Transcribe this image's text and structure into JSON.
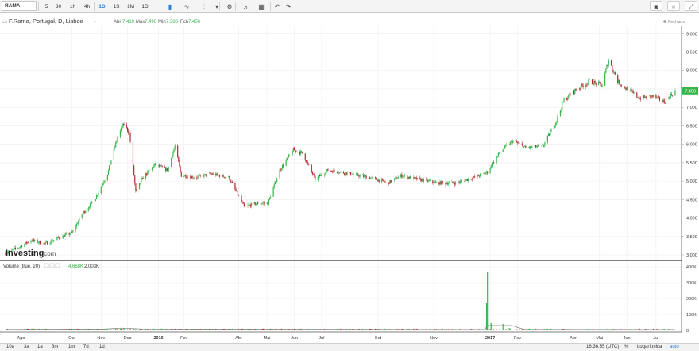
{
  "toolbar": {
    "symbol": "RAMA",
    "intervals": [
      "5",
      "30",
      "1h",
      "4h",
      "1D",
      "1S",
      "1M",
      "1D"
    ],
    "selected_interval": "1D",
    "icons": [
      "candlestick-icon",
      "line-chart-icon",
      "indicator-icon",
      "dropdown-arrow-icon",
      "settings-gear-icon",
      "compare-icon",
      "layout-icon",
      "undo-icon",
      "redo-icon",
      "camera-icon",
      "color-square-icon",
      "fullscreen-icon"
    ]
  },
  "legend": {
    "title": "F.Rama, Portugal, D, Lisboa",
    "abr_label": "Abr",
    "abr_value": "7.419",
    "max_label": "Max",
    "max_value": "7.490",
    "min_label": "Min",
    "min_value": "7.380",
    "fch_label": "Fch",
    "fch_value": "7.450",
    "status": "Fechado"
  },
  "volume_legend": {
    "label": "Volume (true, 20)",
    "v1": "4.668K",
    "v2": "2.003K"
  },
  "watermark": {
    "brand": "Investing",
    "suffix": ".com"
  },
  "price_label": "7.450",
  "bottom": {
    "ranges": [
      "10a",
      "3a",
      "1a",
      "3m",
      "1m",
      "7d",
      "1d"
    ],
    "time": "16:36:55 (UTC)",
    "pct": "%",
    "log": "Logarítmica",
    "auto": "auto"
  },
  "colors": {
    "up": "#39b54a",
    "down": "#b22833",
    "last_line": "#66cc66",
    "axis": "#333333",
    "grid": "#eeeeee"
  },
  "chart_data": [
    {
      "type": "candlestick",
      "title": "F.Rama, Portugal, D, Lisboa",
      "x_ticks": [
        "Ago",
        "Out",
        "Nov",
        "Dez",
        "2016",
        "Fev",
        "Abr",
        "Mai",
        "Jun",
        "Jul",
        "Set",
        "Nov",
        "2017",
        "Fev",
        "Abr",
        "Mai",
        "Jun",
        "Jul"
      ],
      "y_ticks": [
        "3.000",
        "3.500",
        "4.000",
        "4.500",
        "5.000",
        "5.500",
        "6.000",
        "6.500",
        "7.000",
        "7.500",
        "8.000",
        "8.500",
        "9.000"
      ],
      "ylim": [
        2.85,
        9.2
      ],
      "last_value": 7.45,
      "price_path": [
        {
          "d": "2015-07-20",
          "v": 3.05
        },
        {
          "d": "2015-08-03",
          "v": 3.2
        },
        {
          "d": "2015-08-17",
          "v": 3.4
        },
        {
          "d": "2015-09-01",
          "v": 3.3
        },
        {
          "d": "2015-09-15",
          "v": 3.45
        },
        {
          "d": "2015-10-01",
          "v": 3.6
        },
        {
          "d": "2015-10-12",
          "v": 4.1
        },
        {
          "d": "2015-10-26",
          "v": 4.5
        },
        {
          "d": "2015-11-09",
          "v": 5.2
        },
        {
          "d": "2015-11-20",
          "v": 6.2
        },
        {
          "d": "2015-11-27",
          "v": 6.55
        },
        {
          "d": "2015-12-03",
          "v": 6.3
        },
        {
          "d": "2015-12-10",
          "v": 4.7
        },
        {
          "d": "2015-12-18",
          "v": 5.1
        },
        {
          "d": "2015-12-31",
          "v": 5.45
        },
        {
          "d": "2016-01-14",
          "v": 5.3
        },
        {
          "d": "2016-01-22",
          "v": 5.95
        },
        {
          "d": "2016-01-29",
          "v": 5.15
        },
        {
          "d": "2016-02-15",
          "v": 5.1
        },
        {
          "d": "2016-03-01",
          "v": 5.2
        },
        {
          "d": "2016-03-21",
          "v": 5.1
        },
        {
          "d": "2016-04-07",
          "v": 4.3
        },
        {
          "d": "2016-04-21",
          "v": 4.4
        },
        {
          "d": "2016-05-03",
          "v": 4.4
        },
        {
          "d": "2016-05-16",
          "v": 5.3
        },
        {
          "d": "2016-05-31",
          "v": 5.85
        },
        {
          "d": "2016-06-10",
          "v": 5.75
        },
        {
          "d": "2016-06-24",
          "v": 5.05
        },
        {
          "d": "2016-07-08",
          "v": 5.3
        },
        {
          "d": "2016-08-01",
          "v": 5.2
        },
        {
          "d": "2016-08-22",
          "v": 5.1
        },
        {
          "d": "2016-09-12",
          "v": 4.95
        },
        {
          "d": "2016-09-26",
          "v": 5.15
        },
        {
          "d": "2016-10-14",
          "v": 5.05
        },
        {
          "d": "2016-11-04",
          "v": 4.95
        },
        {
          "d": "2016-11-25",
          "v": 4.95
        },
        {
          "d": "2016-12-16",
          "v": 5.1
        },
        {
          "d": "2016-12-30",
          "v": 5.25
        },
        {
          "d": "2017-01-13",
          "v": 5.8
        },
        {
          "d": "2017-01-27",
          "v": 6.1
        },
        {
          "d": "2017-02-10",
          "v": 5.9
        },
        {
          "d": "2017-03-01",
          "v": 5.95
        },
        {
          "d": "2017-03-15",
          "v": 6.6
        },
        {
          "d": "2017-03-24",
          "v": 7.2
        },
        {
          "d": "2017-04-07",
          "v": 7.5
        },
        {
          "d": "2017-04-21",
          "v": 7.7
        },
        {
          "d": "2017-05-05",
          "v": 7.6
        },
        {
          "d": "2017-05-12",
          "v": 8.3
        },
        {
          "d": "2017-05-22",
          "v": 7.7
        },
        {
          "d": "2017-06-01",
          "v": 7.5
        },
        {
          "d": "2017-06-15",
          "v": 7.25
        },
        {
          "d": "2017-06-30",
          "v": 7.3
        },
        {
          "d": "2017-07-12",
          "v": 7.15
        },
        {
          "d": "2017-07-24",
          "v": 7.45
        }
      ]
    },
    {
      "type": "bar",
      "title": "Volume (true, 20)",
      "y_ticks": [
        "0",
        "100K",
        "200K",
        "300K",
        "400K"
      ],
      "ylim": [
        0,
        420000
      ],
      "spikes": [
        {
          "d": "2015-11-09",
          "v": 10000
        },
        {
          "d": "2015-11-16",
          "v": 18000
        },
        {
          "d": "2015-11-27",
          "v": 14000
        },
        {
          "d": "2016-12-29",
          "v": 170000
        },
        {
          "d": "2016-12-30",
          "v": 370000
        },
        {
          "d": "2017-01-03",
          "v": 45000
        },
        {
          "d": "2017-01-16",
          "v": 40000
        },
        {
          "d": "2017-01-23",
          "v": 15000
        }
      ],
      "ma_path": [
        {
          "d": "2015-07-20",
          "v": 6000
        },
        {
          "d": "2015-11-05",
          "v": 8000
        },
        {
          "d": "2015-11-25",
          "v": 14000
        },
        {
          "d": "2015-12-15",
          "v": 9000
        },
        {
          "d": "2016-12-27",
          "v": 5000
        },
        {
          "d": "2016-12-30",
          "v": 30000
        },
        {
          "d": "2017-01-26",
          "v": 30000
        },
        {
          "d": "2017-02-08",
          "v": 6000
        },
        {
          "d": "2017-07-24",
          "v": 5000
        }
      ]
    }
  ]
}
